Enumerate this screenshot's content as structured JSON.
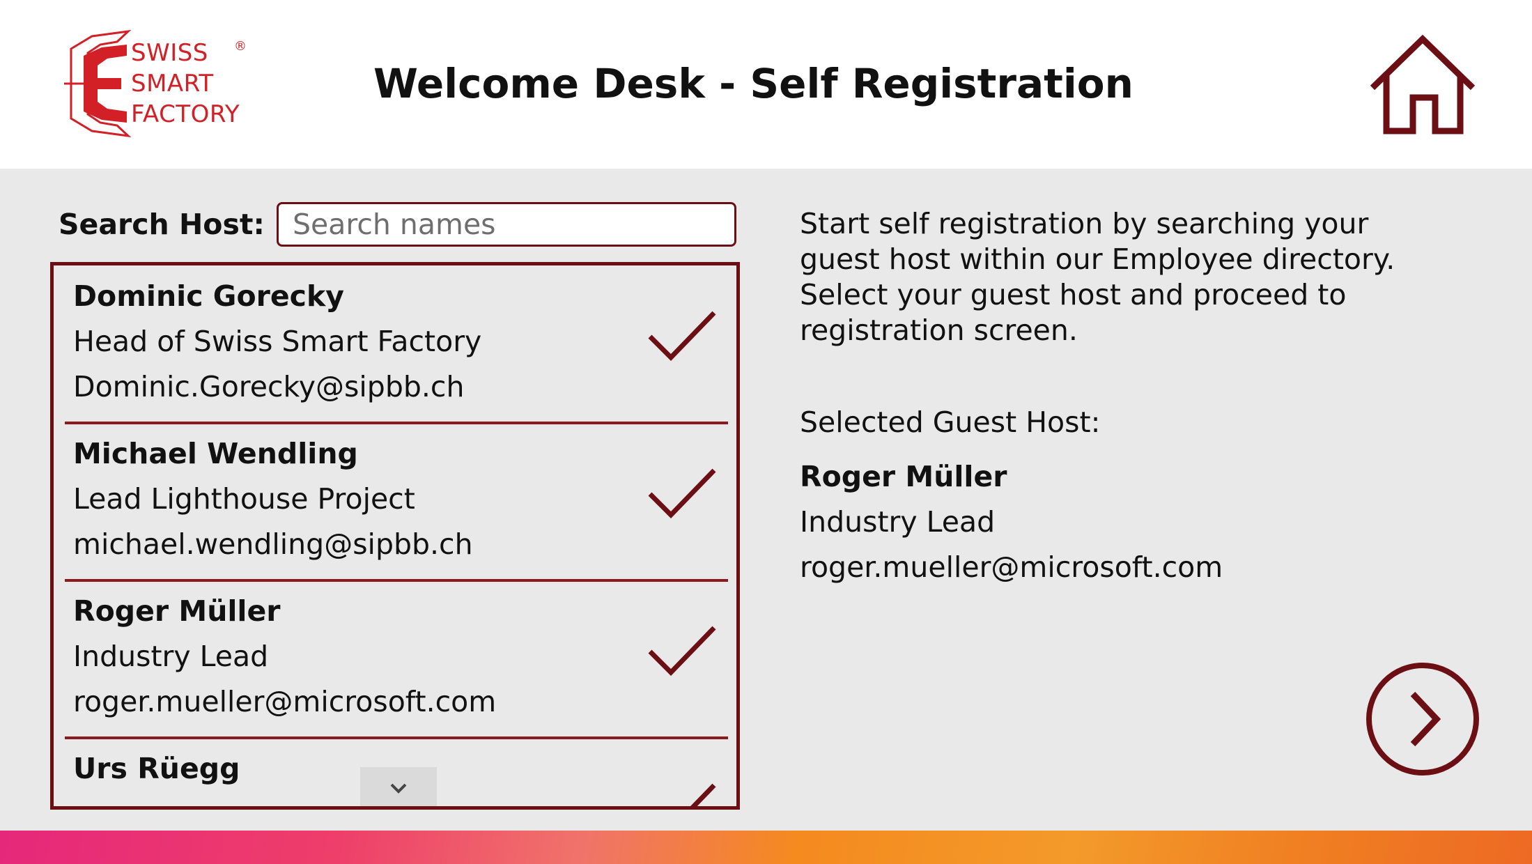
{
  "header": {
    "logo_lines": [
      "SWISS",
      "SMART",
      "FACTORY"
    ],
    "logo_registered": "®",
    "title": "Welcome Desk - Self Registration"
  },
  "search": {
    "label": "Search Host:",
    "placeholder": "Search names",
    "value": ""
  },
  "hosts": [
    {
      "name": "Dominic Gorecky",
      "role": "Head of Swiss Smart Factory",
      "email": "Dominic.Gorecky@sipbb.ch"
    },
    {
      "name": "Michael Wendling",
      "role": "Lead Lighthouse Project",
      "email": "michael.wendling@sipbb.ch"
    },
    {
      "name": "Roger Müller",
      "role": "Industry Lead",
      "email": "roger.mueller@microsoft.com"
    },
    {
      "name": "Urs Rüegg",
      "role": "",
      "email": ""
    }
  ],
  "intro_text": "Start self registration by searching your guest host within our Employee directory. Select your guest host and proceed to registration screen.",
  "selected": {
    "label": "Selected Guest Host:",
    "name": "Roger Müller",
    "role": "Industry Lead",
    "email": "roger.mueller@microsoft.com"
  },
  "icons": {
    "home": "home-icon",
    "check": "check-icon",
    "next": "chevron-right-circle-icon",
    "scroll": "chevron-down-icon"
  },
  "colors": {
    "accent": "#6b0f14",
    "separator": "#8b1a1f",
    "logo": "#d32027",
    "background": "#e9e9e9"
  }
}
